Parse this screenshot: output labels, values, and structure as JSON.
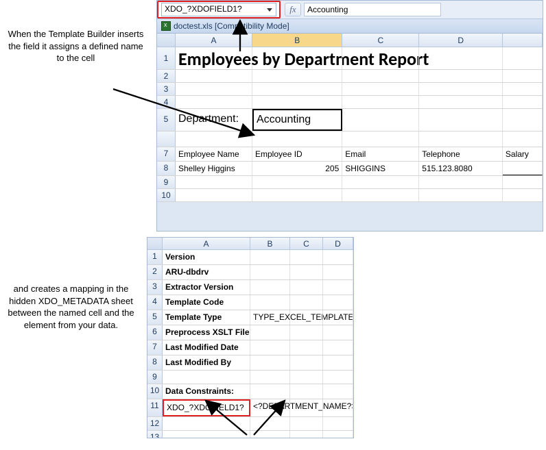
{
  "captions": {
    "top": "When the Template Builder inserts the field it assigns a defined name to the cell",
    "bottom": "and creates a mapping in the hidden XDO_METADATA sheet between the named cell and the element from your data."
  },
  "top_pane": {
    "name_box": "XDO_?XDOFIELD1?",
    "fx_label": "fx",
    "formula_bar": "Accounting",
    "workbook_title": "doctest.xls  [Compatibility Mode]",
    "columns": [
      "A",
      "B",
      "C",
      "D"
    ],
    "title": "Employees by Department Report",
    "department_label": "Department:",
    "department_value": "Accounting",
    "table_headers": [
      "Employee Name",
      "Employee ID",
      "Email",
      "Telephone",
      "Salary"
    ],
    "row8": {
      "name": "Shelley Higgins",
      "id": "205",
      "email": "SHIGGINS",
      "tel": "515.123.8080"
    }
  },
  "bot_pane": {
    "columns": [
      "A",
      "B",
      "C",
      "D"
    ],
    "rows": {
      "1": {
        "A": "Version"
      },
      "2": {
        "A": "ARU-dbdrv"
      },
      "3": {
        "A": "Extractor Version"
      },
      "4": {
        "A": "Template Code"
      },
      "5": {
        "A": "Template Type",
        "B": "TYPE_EXCEL_TEMPLATE"
      },
      "6": {
        "A": "Preprocess XSLT File"
      },
      "7": {
        "A": "Last Modified Date"
      },
      "8": {
        "A": "Last Modified By"
      },
      "10": {
        "A": "Data Constraints:"
      },
      "11": {
        "A": "XDO_?XDOFIELD1?",
        "B": "<?DEPARTMENT_NAME?>"
      }
    }
  }
}
